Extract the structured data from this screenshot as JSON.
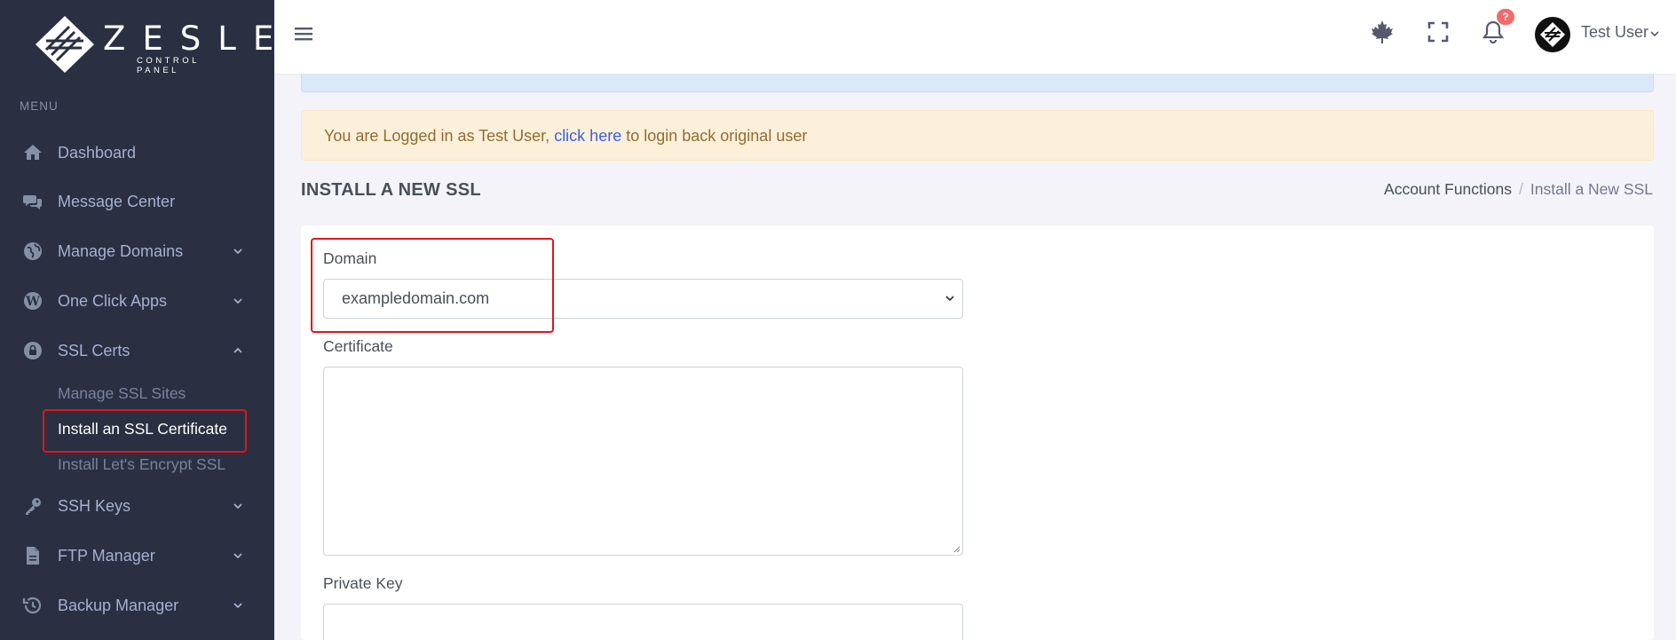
{
  "brand": {
    "word": "ZESLE",
    "sub": "CONTROL PANEL"
  },
  "sidebar": {
    "menu_title": "MENU",
    "items": [
      {
        "label": "Dashboard",
        "icon": "home-icon"
      },
      {
        "label": "Message Center",
        "icon": "chat-icon"
      },
      {
        "label": "Manage Domains",
        "icon": "globe-icon",
        "chevron": "down"
      },
      {
        "label": "One Click Apps",
        "icon": "wordpress-icon",
        "chevron": "down"
      },
      {
        "label": "SSL Certs",
        "icon": "lock-icon",
        "chevron": "up"
      },
      {
        "label": "SSH Keys",
        "icon": "key-icon",
        "chevron": "down"
      },
      {
        "label": "FTP Manager",
        "icon": "file-icon",
        "chevron": "down"
      },
      {
        "label": "Backup Manager",
        "icon": "history-icon",
        "chevron": "down"
      }
    ],
    "ssl_sub": [
      {
        "label": "Manage SSL Sites"
      },
      {
        "label": "Install an SSL Certificate",
        "active": true
      },
      {
        "label": "Install Let's Encrypt SSL"
      }
    ]
  },
  "topbar": {
    "notification_count": "?",
    "user_name": "Test User",
    "icons": [
      "menu-icon",
      "maple-leaf-icon",
      "fullscreen-icon",
      "bell-icon"
    ]
  },
  "alert": {
    "prefix": "You are Logged in as Test User, ",
    "link": "click here",
    "suffix": " to login back original user"
  },
  "page": {
    "title": "INSTALL A NEW SSL",
    "breadcrumb": [
      "Account Functions",
      "Install a New SSL"
    ]
  },
  "form": {
    "domain_label": "Domain",
    "domain_value": "exampledomain.com",
    "certificate_label": "Certificate",
    "certificate_value": "",
    "private_key_label": "Private Key",
    "private_key_value": ""
  },
  "colors": {
    "sidebar_bg": "#2a3042",
    "highlight": "#e0161c",
    "link": "#3c5fe0",
    "alert_bg": "#fcf0db",
    "badge": "#f46a6a"
  }
}
